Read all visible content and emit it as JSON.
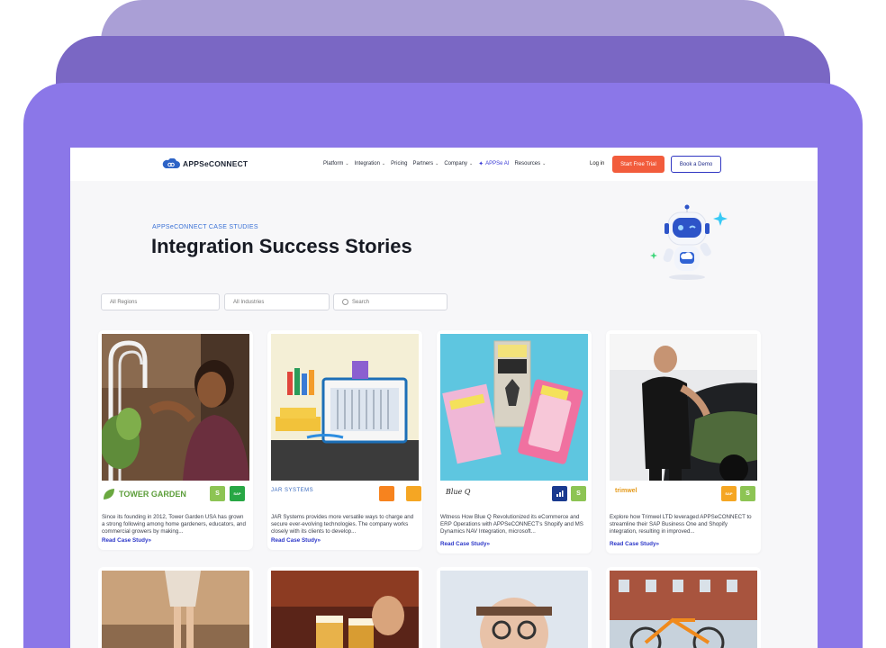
{
  "nav": {
    "logo_text": "APPSeCONNECT",
    "menu": [
      {
        "label": "Platform",
        "chevron": true
      },
      {
        "label": "Integration",
        "chevron": true
      },
      {
        "label": "Pricing",
        "chevron": false
      },
      {
        "label": "Partners",
        "chevron": true
      },
      {
        "label": "Company",
        "chevron": true
      },
      {
        "label": "APPSe AI",
        "chevron": false,
        "icon": "sparkle-icon",
        "accent": true
      },
      {
        "label": "Resources",
        "chevron": true
      }
    ],
    "login": "Log in",
    "trial": "Start Free Trial",
    "demo": "Book a Demo"
  },
  "hero": {
    "eyebrow": "APPSeCONNECT CASE STUDIES",
    "title": "Integration Success Stories"
  },
  "filters": {
    "regions": "All Regions",
    "industries": "All Industries",
    "search_placeholder": "Search"
  },
  "cards": [
    {
      "brand": "TOWER GARDEN",
      "desc": "Since its founding in 2012, Tower Garden USA has grown a strong following among home gardeners, educators, and commercial growers by making...",
      "link": "Read Case Study"
    },
    {
      "brand": "JAR SYSTEMS",
      "desc": "JAR Systems provides more versatile ways to charge and secure ever-evolving technologies. The company works closely with its clients to develop...",
      "link": "Read Case Study"
    },
    {
      "brand": "Blue Q",
      "desc": "Witness How Blue Q Revolutionized its eCommerce and ERP Operations with APPSeCONNECT's Shopify and MS Dynamics NAV Integration, microsoft...",
      "link": "Read Case Study"
    },
    {
      "brand": "trimwel",
      "desc": "Explore how Trimwel LTD leveraged APPSeCONNECT to streamline their SAP Business One and Shopify integration, resulting in improved...",
      "link": "Read Case Study"
    }
  ],
  "colors": {
    "accent": "#3a3bd6",
    "trial_button": "#f25c3c",
    "purple_frame": "#8b77e8"
  }
}
